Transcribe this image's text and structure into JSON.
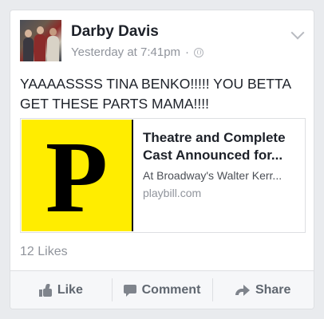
{
  "post": {
    "author": "Darby Davis",
    "timestamp": "Yesterday at 7:41pm",
    "separator": "·",
    "audience_icon": "globe-icon",
    "menu_icon": "chevron-down-icon",
    "text": "YAAAASSSS TINA BENKO!!!!! YOU BETTA GET THESE PARTS MAMA!!!!"
  },
  "link_preview": {
    "thumbnail_letter": "P",
    "thumbnail_bg": "#ffed00",
    "title_line1": "Theatre and Complete",
    "title_line2": "Cast Announced for...",
    "description": "At Broadway's Walter Kerr...",
    "domain": "playbill.com"
  },
  "reactions": {
    "likes": "12 Likes"
  },
  "actions": {
    "like_label": "Like",
    "like_icon": "thumbs-up-icon",
    "comment_label": "Comment",
    "comment_icon": "comment-icon",
    "share_label": "Share",
    "share_icon": "share-arrow-icon"
  },
  "colors": {
    "text": "#1d2129",
    "secondary": "#90949c",
    "action_bar_bg": "#f6f7f9"
  }
}
